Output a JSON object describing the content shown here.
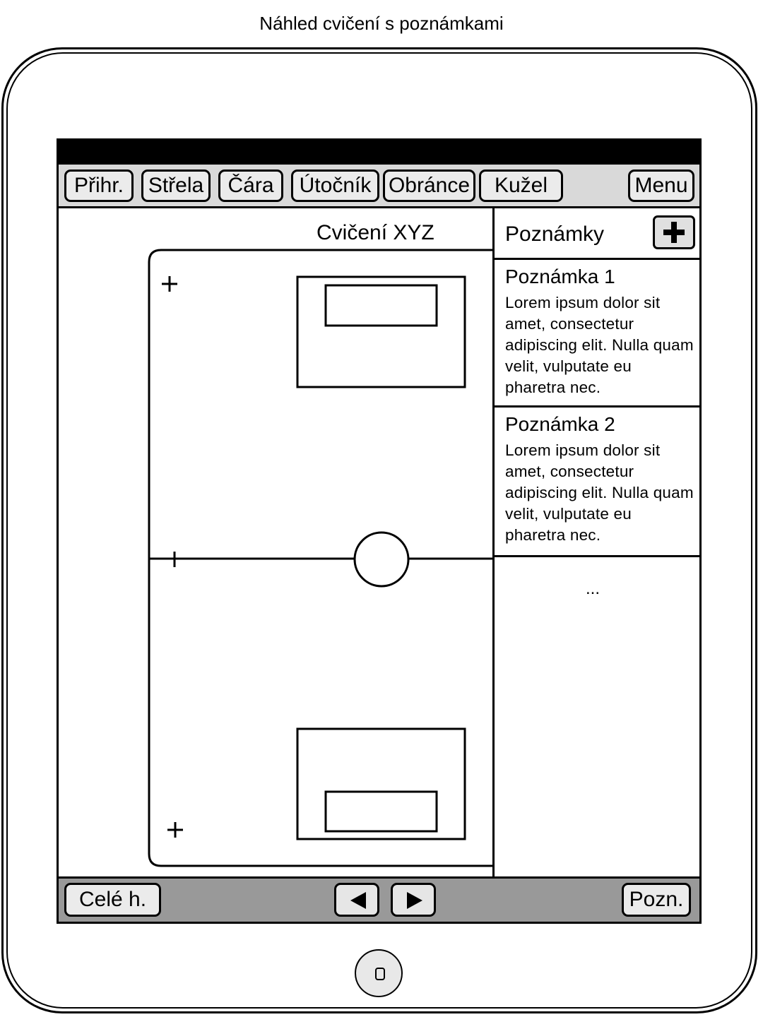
{
  "caption": "Náhled cvičení s poznámkami",
  "toolbar": {
    "tools": [
      "Přihr.",
      "Střela",
      "Čára",
      "Útočník",
      "Obránce",
      "Kužel"
    ],
    "menu_label": "Menu"
  },
  "canvas": {
    "title": "Cvičení XYZ"
  },
  "notes": {
    "title": "Poznámky",
    "add_icon": "plus-icon",
    "items": [
      {
        "title": "Poznámka 1",
        "body": "Lorem ipsum dolor sit amet, consectetur adipiscing elit. Nulla quam velit, vulputate eu pharetra nec."
      },
      {
        "title": "Poznámka 2",
        "body": "Lorem ipsum dolor sit amet, consectetur adipiscing elit. Nulla quam velit, vulputate eu pharetra nec."
      }
    ],
    "more": "..."
  },
  "bottom_bar": {
    "fullscreen_label": "Celé h.",
    "prev_icon": "triangle-left-icon",
    "next_icon": "triangle-right-icon",
    "notes_label": "Pozn."
  },
  "colors": {
    "toolbar_bg": "#d9d9d9",
    "bottom_bar_bg": "#999999",
    "button_bg": "#ebebeb"
  }
}
